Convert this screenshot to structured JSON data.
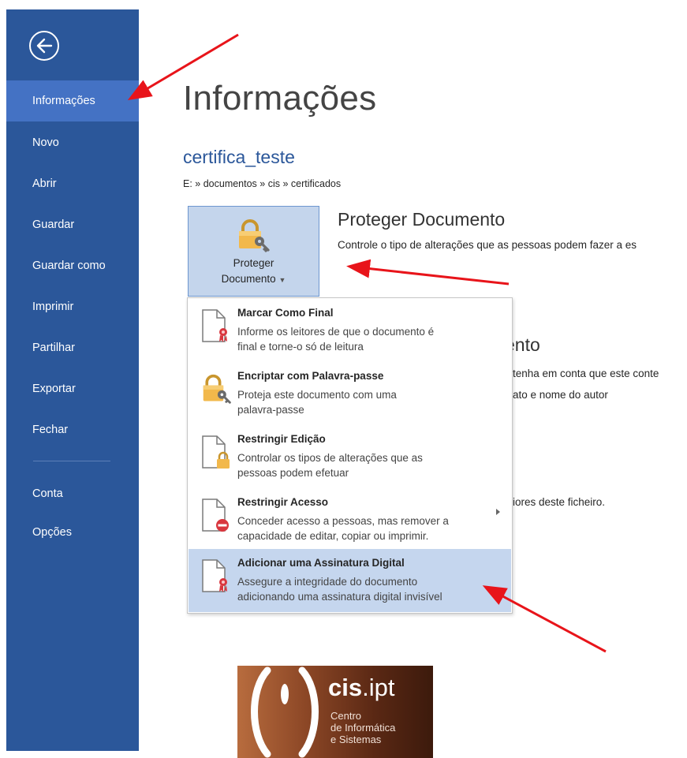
{
  "sidebar": {
    "items": [
      {
        "label": "Informações",
        "active": true
      },
      {
        "label": "Novo"
      },
      {
        "label": "Abrir"
      },
      {
        "label": "Guardar"
      },
      {
        "label": "Guardar como"
      },
      {
        "label": "Imprimir"
      },
      {
        "label": "Partilhar"
      },
      {
        "label": "Exportar"
      },
      {
        "label": "Fechar"
      },
      {
        "label": "Conta"
      },
      {
        "label": "Opções"
      }
    ],
    "back_icon": "back-arrow-icon",
    "color": "#2b579a",
    "active_color": "#4472c4"
  },
  "main": {
    "title": "Informações",
    "doc_name": "certifica_teste",
    "path": "E: » documentos » cis » certificados",
    "protect_button": {
      "line1": "Proteger",
      "line2": "Documento",
      "icon": "lock-key-icon"
    },
    "protect_heading": "Proteger Documento",
    "protect_desc": "Controle o tipo de alterações que as pessoas podem fazer a es",
    "bg_heading2": "ento",
    "bg_line1": "tenha em conta que este conte",
    "bg_line2": "ato e nome do autor",
    "bg_line3": "iores deste ficheiro."
  },
  "menu": {
    "items": [
      {
        "title": "Marcar Como Final",
        "desc1": "Informe os leitores de que o documento é",
        "desc2": "final e torne-o só de leitura",
        "icon": "document-ribbon-icon"
      },
      {
        "title": "Encriptar com Palavra-passe",
        "desc1": "Proteja este documento com uma",
        "desc2": "palavra-passe",
        "icon": "lock-key-icon"
      },
      {
        "title": "Restringir Edição",
        "desc1": "Controlar os tipos de alterações que as",
        "desc2": "pessoas podem efetuar",
        "icon": "document-lock-icon"
      },
      {
        "title": "Restringir Acesso",
        "desc1": "Conceder acesso a pessoas, mas remover a",
        "desc2": "capacidade de editar, copiar ou imprimir.",
        "icon": "document-restricted-icon",
        "submenu": true
      },
      {
        "title": "Adicionar uma Assinatura Digital",
        "desc1": "Assegure a integridade do documento",
        "desc2": "adicionando uma assinatura digital invisível",
        "icon": "document-ribbon-icon",
        "highlighted": true
      }
    ]
  },
  "logo": {
    "wordmark_bold": "cis",
    "wordmark_rest": ".ipt",
    "line1": "Centro",
    "line2": "de Informática",
    "line3": "e Sistemas"
  },
  "annotation_color": "#e8141a"
}
